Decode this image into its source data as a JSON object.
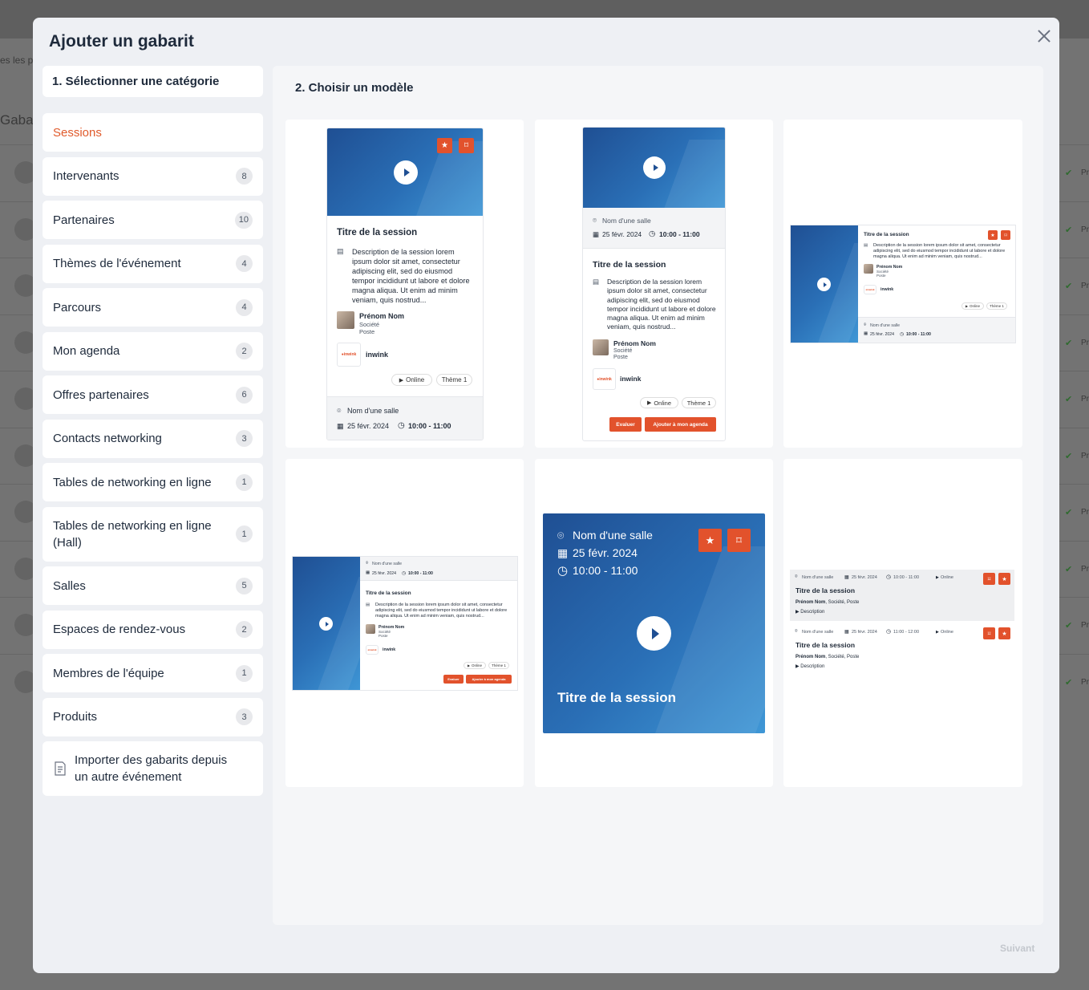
{
  "background": {
    "breadcrumb": "es les p",
    "title": "Gabar",
    "row_tail": "Pr"
  },
  "modal": {
    "title": "Ajouter un gabarit",
    "close_icon": "close-icon",
    "next_label": "Suivant"
  },
  "step1": {
    "label": "1. Sélectionner une catégorie",
    "categories": [
      {
        "label": "Sessions",
        "count": "",
        "active": true
      },
      {
        "label": "Intervenants",
        "count": "8"
      },
      {
        "label": "Partenaires",
        "count": "10"
      },
      {
        "label": "Thèmes de l'événement",
        "count": "4"
      },
      {
        "label": "Parcours",
        "count": "4"
      },
      {
        "label": "Mon agenda",
        "count": "2"
      },
      {
        "label": "Offres partenaires",
        "count": "6"
      },
      {
        "label": "Contacts networking",
        "count": "3"
      },
      {
        "label": "Tables de networking en ligne",
        "count": "1"
      },
      {
        "label": "Tables de networking en ligne (Hall)",
        "count": "1"
      },
      {
        "label": "Salles",
        "count": "5"
      },
      {
        "label": "Espaces de rendez-vous",
        "count": "2"
      },
      {
        "label": "Membres de l'équipe",
        "count": "1"
      },
      {
        "label": "Produits",
        "count": "3"
      }
    ],
    "import_label": "Importer des gabarits depuis un autre événement"
  },
  "step2": {
    "label": "2. Choisir un modèle"
  },
  "template": {
    "session_title": "Titre de la session",
    "description": "Description de la session lorem ipsum dolor sit amet, consectetur adipiscing elit, sed do eiusmod tempor incididunt ut labore et dolore magna aliqua. Ut enim ad minim veniam, quis nostrud...",
    "description_short": "Description",
    "speaker_name": "Prénom Nom",
    "speaker_company": "Société",
    "speaker_position": "Poste",
    "speaker_inline_rest": ", Société, Poste",
    "partner": "inwink",
    "format": "Online",
    "theme": "Thème 1",
    "room": "Nom d'une salle",
    "date": "25 févr. 2024",
    "time": "10:00 - 11:00",
    "time_2": "11:00 - 12:00",
    "rate_button": "Evaluer",
    "agenda_button": "Ajouter à mon agenda"
  }
}
